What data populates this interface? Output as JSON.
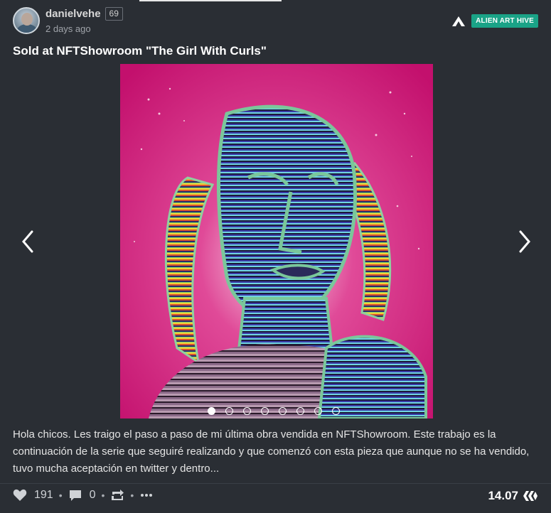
{
  "post": {
    "author": "danielvehe",
    "reputation": "69",
    "time_ago": "2 days ago",
    "community": "ALIEN ART HIVE",
    "title": "Sold at NFTShowroom \"The Girl With Curls\"",
    "body": "Hola chicos. Les traigo el paso a paso de mi última obra vendida en NFTShowroom. Este trabajo es la continuación de la serie que seguiré realizando y que comenzó con esta pieza que aunque no se ha vendido, tuvo mucha aceptación en twitter y dentro..."
  },
  "carousel": {
    "slide_count": 8,
    "active_slide": 1,
    "image_description": "Colorful striped portrait of a girl with curls on magenta background"
  },
  "footer": {
    "votes": "191",
    "comments": "0",
    "payout": "14.07"
  },
  "colors": {
    "background": "#2a2e34",
    "community_badge": "#1aa387",
    "artwork_bg": "#d81a7c"
  },
  "icons": [
    "heart-icon",
    "comment-icon",
    "reblog-icon",
    "more-icon",
    "hive-icon",
    "chevron-left-icon",
    "chevron-right-icon",
    "community-logo-icon"
  ]
}
